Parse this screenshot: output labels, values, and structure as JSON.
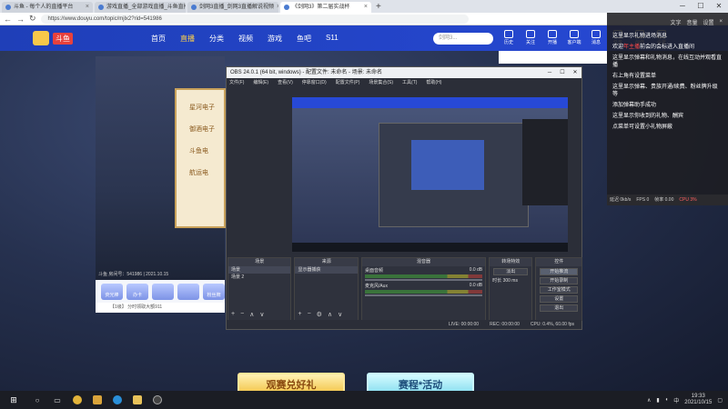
{
  "browser": {
    "tabs": [
      {
        "label": "斗鱼 - 每个人的直播平台"
      },
      {
        "label": "游戏直播_全部游戏直播_斗鱼直播"
      },
      {
        "label": "剑网3直播_剑网3直播解说视频"
      },
      {
        "label": "《剑网3》第二届实战杯"
      }
    ],
    "new_tab": "+",
    "url": "https://www.douyu.com/topic/mjlx2?rid=541986"
  },
  "douyu": {
    "badge": "斗鱼",
    "nav": [
      "首页",
      "直播",
      "分类",
      "视频",
      "游戏",
      "鱼吧",
      "S11"
    ],
    "active_nav": "直播",
    "search_placeholder": "剑网3...",
    "icons": [
      "历史",
      "关注",
      "开播",
      "客户端",
      "消息",
      "任务",
      "创作",
      "设置"
    ]
  },
  "stream": {
    "card_lines": [
      "星河电子",
      "御酒电子",
      "斗鱼电",
      "航运电"
    ],
    "meta": "斗鱼 房间号：541986 | 2021.10.15",
    "gifts": [
      "荧光棒",
      "办卡",
      "",
      "",
      "粉丝牌"
    ],
    "notice": "【1级】 分时领取大额911"
  },
  "obs": {
    "title": "OBS 24.0.1 (64 bit, windows) - 配置文件: 未命名 - 场景: 未命名",
    "menu": [
      "文件(F)",
      "编辑(E)",
      "查看(V)",
      "停靠窗口(D)",
      "配置文件(P)",
      "场景集合(S)",
      "工具(T)",
      "帮助(H)"
    ],
    "panels": {
      "scenes": {
        "header": "场景",
        "items": [
          "场景",
          "场景 2"
        ]
      },
      "sources": {
        "header": "来源",
        "items": [
          "显示器捕获"
        ]
      },
      "mixer": {
        "header": "混音器",
        "rows": [
          {
            "name": "桌面音频",
            "db": "0.0 dB"
          },
          {
            "name": "麦克风/Aux",
            "db": "0.0 dB"
          }
        ]
      },
      "transitions": {
        "header": "转场特效",
        "type": "淡出",
        "duration_label": "时长",
        "duration": "300 ms"
      },
      "controls": {
        "header": "控件",
        "buttons": [
          "开始推流",
          "开始录制",
          "工作室模式",
          "设置",
          "退出"
        ]
      }
    },
    "status": [
      "LIVE: 00:00:00",
      "REC: 00:00:00",
      "CPU: 0.4%, 60.00 fps"
    ]
  },
  "chat": {
    "header": [
      "文字",
      "音量",
      "设置",
      "×"
    ],
    "lines": [
      {
        "text": "这里显示礼物进场消息"
      },
      {
        "prefix": "欢迎",
        "highlight": "年主播",
        "suffix": "前会的会标进入直播间"
      },
      {
        "text": "这里显示弹幕和礼物消息，在线互动并观看直播"
      },
      {
        "text": "右上角有设置菜单"
      },
      {
        "text": "这里显示弹幕、贵族开通/续费、粉丝牌升级等"
      },
      {
        "text": "添加弹幕助手成功"
      },
      {
        "text": "这里显示你收到的礼物、酬宾"
      },
      {
        "text": "点菜单可设置小礼物屏蔽"
      }
    ],
    "footer": [
      "延迟 0kb/s",
      "FPS 0",
      "帧率 0.00"
    ],
    "footer_red": "CPU 3%"
  },
  "promo": {
    "gold": "观赛兑好礼",
    "blue": "赛程*活动"
  },
  "taskbar": {
    "time": "19:33",
    "date": "2021/10/15",
    "ime": "中"
  },
  "colors": {
    "douyu_blue": "#2749d6",
    "obs_bg": "#2b2e38",
    "chat_bg": "#1e1e22"
  }
}
